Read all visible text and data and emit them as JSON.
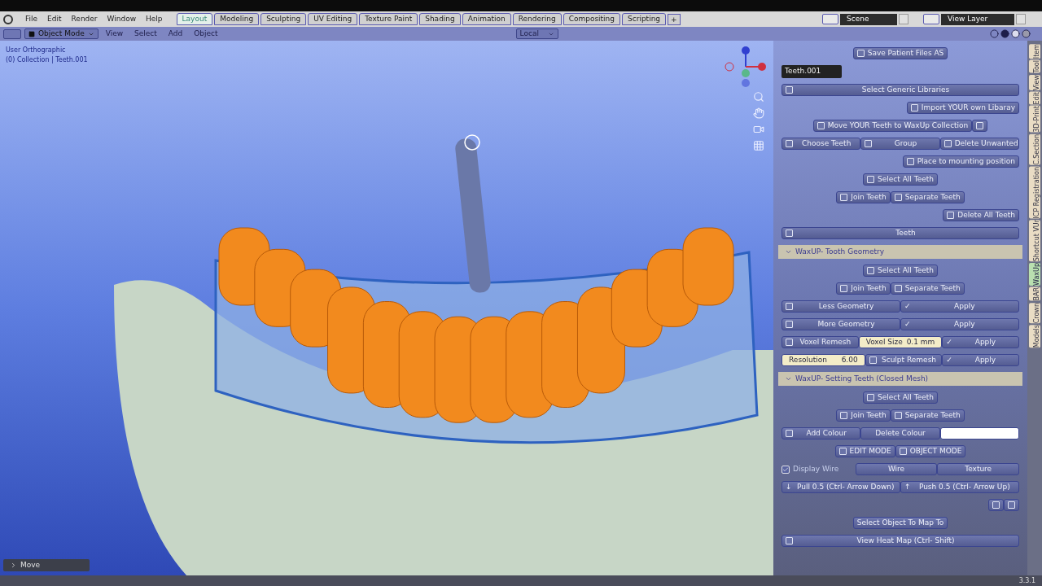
{
  "menu": [
    "File",
    "Edit",
    "Render",
    "Window",
    "Help"
  ],
  "workspaces": [
    {
      "label": "Layout",
      "selected": true
    },
    {
      "label": "Modeling",
      "selected": false
    },
    {
      "label": "Sculpting",
      "selected": false
    },
    {
      "label": "UV Editing",
      "selected": false
    },
    {
      "label": "Texture Paint",
      "selected": false
    },
    {
      "label": "Shading",
      "selected": false
    },
    {
      "label": "Animation",
      "selected": false
    },
    {
      "label": "Rendering",
      "selected": false
    },
    {
      "label": "Compositing",
      "selected": false
    },
    {
      "label": "Scripting",
      "selected": false
    }
  ],
  "add_workspace": "+",
  "scene": "Scene",
  "view_layer": "View Layer",
  "header": {
    "mode": "Object Mode",
    "menus": [
      "View",
      "Select",
      "Add",
      "Object"
    ],
    "orientation": "Local"
  },
  "viewport": {
    "overlay": [
      "User Orthographic",
      "(0) Collection | Teeth.001"
    ],
    "last_operator": "Move"
  },
  "sidebar_rows": [
    {
      "kind": "centered",
      "items": [
        {
          "label": "Save Patient Files AS",
          "icon": true
        }
      ]
    },
    {
      "kind": "field",
      "value": "Teeth.001"
    },
    {
      "kind": "full",
      "items": [
        {
          "label": "Select Generic Libraries",
          "icon": true
        }
      ]
    },
    {
      "kind": "right",
      "items": [
        {
          "label": "Import YOUR own Libaray",
          "icon": true
        }
      ]
    },
    {
      "kind": "centered",
      "items": [
        {
          "label": "Move YOUR Teeth to WaxUp Collection",
          "icon": true
        },
        {
          "icon": true
        }
      ]
    },
    {
      "kind": "full",
      "items": [
        {
          "label": "Choose Teeth",
          "icon": true
        },
        {
          "label": "Group",
          "icon": true
        },
        {
          "label": "Delete Unwanted",
          "icon": true
        }
      ]
    },
    {
      "kind": "right",
      "items": [
        {
          "label": "Place to  mounting position",
          "icon": true
        }
      ]
    },
    {
      "kind": "centered",
      "items": [
        {
          "label": "Select All Teeth",
          "icon": true
        }
      ]
    },
    {
      "kind": "centered",
      "items": [
        {
          "label": "Join Teeth",
          "icon": true
        },
        {
          "label": "Separate Teeth",
          "icon": true
        }
      ]
    },
    {
      "kind": "right",
      "items": [
        {
          "label": "Delete All Teeth",
          "icon": true
        }
      ]
    },
    {
      "kind": "full",
      "items": [
        {
          "label": "Teeth",
          "icon": true
        }
      ]
    },
    {
      "kind": "header",
      "label": "WaxUP- Tooth Geometry",
      "expanded": true
    },
    {
      "kind": "centered",
      "items": [
        {
          "label": "Select All Teeth",
          "icon": true
        }
      ]
    },
    {
      "kind": "centered",
      "items": [
        {
          "label": "Join Teeth",
          "icon": true
        },
        {
          "label": "Separate Teeth",
          "icon": true
        }
      ]
    },
    {
      "kind": "full",
      "items": [
        {
          "label": "Less Geometry",
          "icon": true
        },
        {
          "label": "Apply",
          "glyph": "✓"
        }
      ]
    },
    {
      "kind": "full",
      "items": [
        {
          "label": "More Geometry",
          "icon": true
        },
        {
          "label": "Apply",
          "glyph": "✓"
        }
      ]
    },
    {
      "kind": "full",
      "items": [
        {
          "label": "Voxel Remesh",
          "icon": true
        },
        {
          "kind": "number",
          "label": "Voxel Size",
          "value": "0.1 mm"
        },
        {
          "label": "Apply",
          "glyph": "✓"
        }
      ]
    },
    {
      "kind": "full",
      "items": [
        {
          "kind": "number",
          "label": "Resolution",
          "value": "6.00"
        },
        {
          "label": "Sculpt Remesh",
          "icon": true
        },
        {
          "label": "Apply",
          "glyph": "✓"
        }
      ]
    },
    {
      "kind": "header",
      "label": "WaxUP- Setting Teeth (Closed Mesh)",
      "expanded": true
    },
    {
      "kind": "centered",
      "items": [
        {
          "label": "Select All Teeth",
          "icon": true
        }
      ]
    },
    {
      "kind": "centered",
      "items": [
        {
          "label": "Join Teeth",
          "icon": true
        },
        {
          "label": "Separate Teeth",
          "icon": true
        }
      ]
    },
    {
      "kind": "full",
      "items": [
        {
          "label": "Add Colour",
          "icon": true
        },
        {
          "label": "Delete Colour"
        },
        {
          "kind": "swatch",
          "color": "#ffffff"
        }
      ]
    },
    {
      "kind": "centered",
      "items": [
        {
          "label": "EDIT MODE",
          "icon": true
        },
        {
          "label": "OBJECT MODE",
          "icon": true
        }
      ]
    },
    {
      "kind": "full",
      "items": [
        {
          "kind": "check",
          "label": "Display Wire",
          "checked": true
        },
        {
          "label": "Wire"
        },
        {
          "label": "Texture"
        }
      ]
    },
    {
      "kind": "full",
      "items": [
        {
          "label": "Pull 0.5 (Ctrl- Arrow Down)",
          "glyph": "↓"
        },
        {
          "label": "Push 0.5 (Ctrl- Arrow Up)",
          "glyph": "↑"
        }
      ]
    },
    {
      "kind": "right",
      "items": [
        {
          "icon": true
        },
        {
          "icon": true
        }
      ]
    },
    {
      "kind": "centered",
      "items": [
        {
          "label": "Select Object To Map To"
        }
      ]
    },
    {
      "kind": "full",
      "items": [
        {
          "label": "View Heat Map (Ctrl- Shift)",
          "icon": true
        }
      ]
    }
  ],
  "sidebar_tabs": [
    {
      "label": "Item",
      "selected": false
    },
    {
      "label": "Tool",
      "selected": false
    },
    {
      "label": "View",
      "selected": false
    },
    {
      "label": "Edit",
      "selected": false
    },
    {
      "label": "3D-Print",
      "selected": false
    },
    {
      "label": "C.Section",
      "selected": false
    },
    {
      "label": "ICP Registration",
      "selected": false
    },
    {
      "label": "Shortcut VUr",
      "selected": false
    },
    {
      "label": "WaxUp",
      "selected": true
    },
    {
      "label": "BAR",
      "selected": false
    },
    {
      "label": "Crown",
      "selected": false
    },
    {
      "label": "Models",
      "selected": false
    }
  ],
  "version": "3.3.1"
}
